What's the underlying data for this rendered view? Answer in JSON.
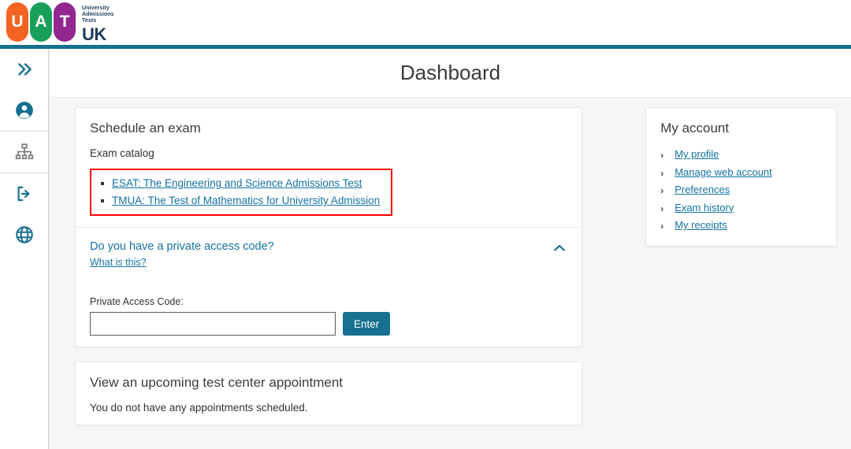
{
  "header": {
    "logo": {
      "tiles": [
        {
          "letter": "U",
          "color": "#F26322"
        },
        {
          "letter": "A",
          "color": "#18A05B"
        },
        {
          "letter": "T",
          "color": "#92278F"
        }
      ],
      "small_lines": [
        "University",
        "Admissions",
        "Tests"
      ],
      "wordmark": "UK"
    },
    "accent_color": "#16708F"
  },
  "sidebar": {
    "items": [
      {
        "name": "expand-sidebar",
        "icon": "double-chevron-right-icon"
      },
      {
        "name": "account",
        "icon": "person-circle-icon"
      },
      {
        "name": "organization",
        "icon": "sitemap-icon"
      },
      {
        "name": "sign-out",
        "icon": "logout-icon"
      },
      {
        "name": "language",
        "icon": "globe-icon"
      }
    ]
  },
  "page": {
    "title": "Dashboard"
  },
  "schedule_card": {
    "title": "Schedule an exam",
    "catalog_label": "Exam catalog",
    "exams": [
      "ESAT: The Engineering and Science Admissions Test",
      "TMUA: The Test of Mathematics for University Admission"
    ],
    "highlight_color": "#ff0000"
  },
  "private_access": {
    "question": "Do you have a private access code?",
    "what_is_this": "What is this?",
    "field_label": "Private Access Code:",
    "input_value": "",
    "input_placeholder": "",
    "enter_label": "Enter",
    "collapse_icon": "chevron-up-icon"
  },
  "appointment_card": {
    "title": "View an upcoming test center appointment",
    "message": "You do not have any appointments scheduled."
  },
  "my_account": {
    "title": "My account",
    "links": [
      "My profile",
      "Manage web account",
      "Preferences",
      "Exam history",
      "My receipts"
    ]
  }
}
